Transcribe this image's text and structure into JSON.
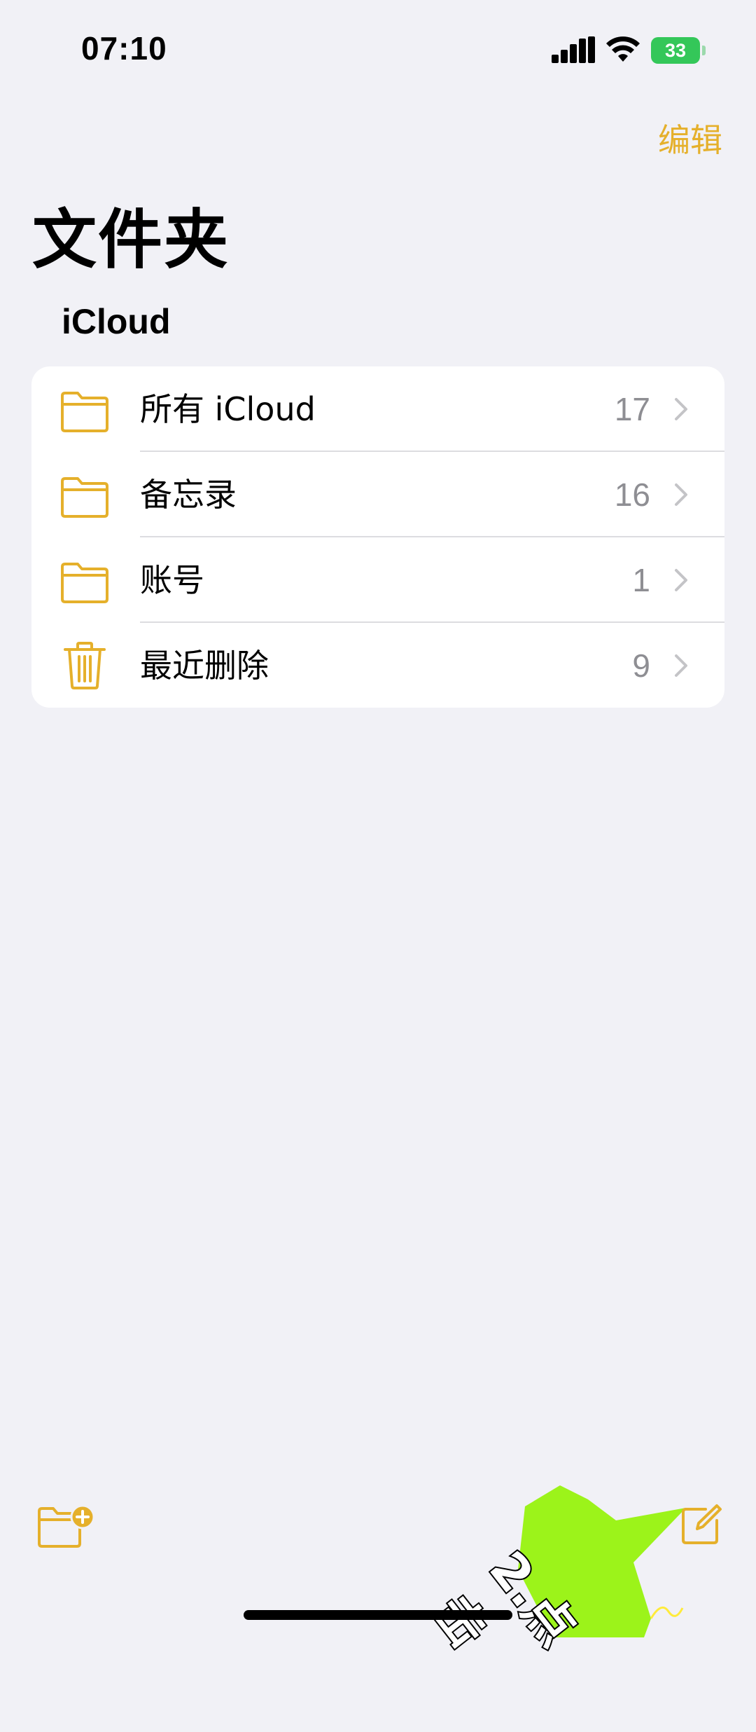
{
  "status_bar": {
    "time": "07:10",
    "battery": "33"
  },
  "nav": {
    "edit_label": "编辑"
  },
  "page": {
    "title": "文件夹",
    "section_title": "iCloud"
  },
  "folders": [
    {
      "label": "所有 iCloud",
      "count": "17",
      "icon": "folder-icon"
    },
    {
      "label": "备忘录",
      "count": "16",
      "icon": "folder-icon"
    },
    {
      "label": "账号",
      "count": "1",
      "icon": "folder-icon"
    },
    {
      "label": "最近删除",
      "count": "9",
      "icon": "trash-icon"
    }
  ],
  "toolbar": {
    "new_folder_icon": "new-folder-icon",
    "compose_icon": "compose-icon"
  },
  "overlay": {
    "callout_text": "2.点击"
  },
  "colors": {
    "accent": "#e5b02b",
    "battery": "#34c759",
    "background": "#f1f1f6",
    "callout": "#9cf31a"
  }
}
